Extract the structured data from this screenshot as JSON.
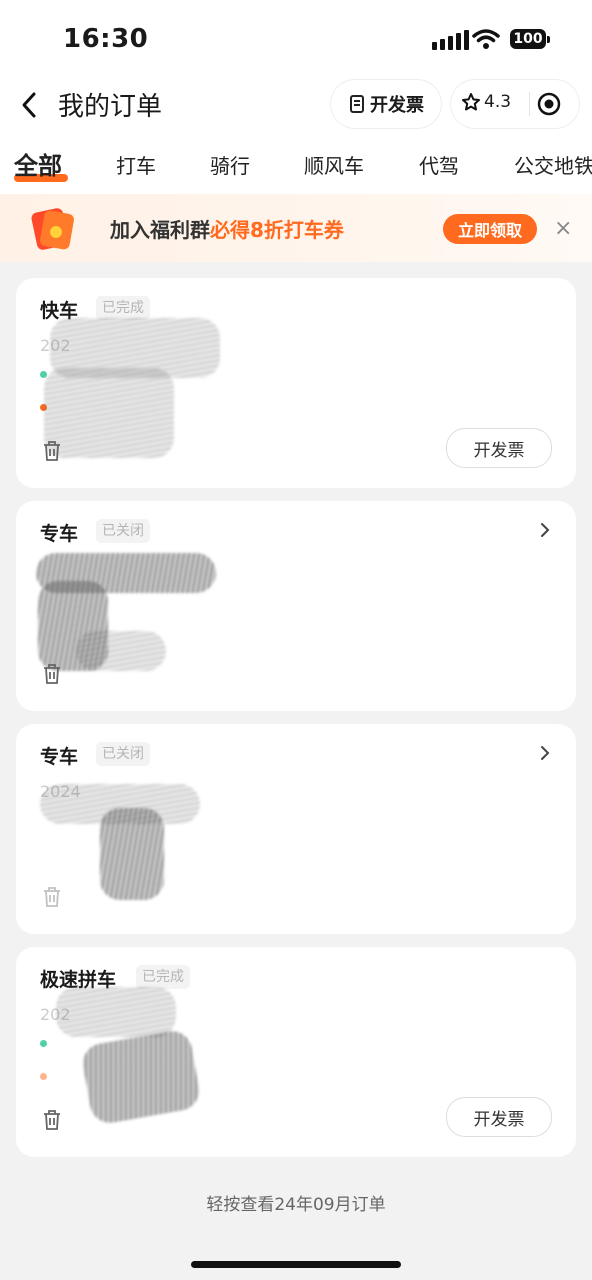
{
  "status_bar": {
    "time": "16:30",
    "battery": "100"
  },
  "header": {
    "title": "我的订单",
    "invoice_label": "开发票",
    "rating": "4.3"
  },
  "tabs": [
    {
      "label": "全部",
      "active": true
    },
    {
      "label": "打车"
    },
    {
      "label": "骑行"
    },
    {
      "label": "顺风车"
    },
    {
      "label": "代驾"
    },
    {
      "label": "公交地铁"
    }
  ],
  "banner": {
    "text_main": "加入福利群",
    "text_highlight": "必得8折打车券",
    "button": "立即领取",
    "close": "×"
  },
  "orders": [
    {
      "type": "快车",
      "status": "已完成",
      "date": "202",
      "action": "开发票"
    },
    {
      "type": "专车",
      "status": "已关闭"
    },
    {
      "type": "专车",
      "status": "已关闭",
      "date": "2024"
    },
    {
      "type": "极速拼车",
      "status": "已完成",
      "date": "202",
      "action": "开发票"
    }
  ],
  "footer": {
    "link": "轻按查看24年09月订单"
  },
  "colors": {
    "accent": "#ff6a1f",
    "background": "#f2f2f2",
    "card": "#ffffff"
  }
}
